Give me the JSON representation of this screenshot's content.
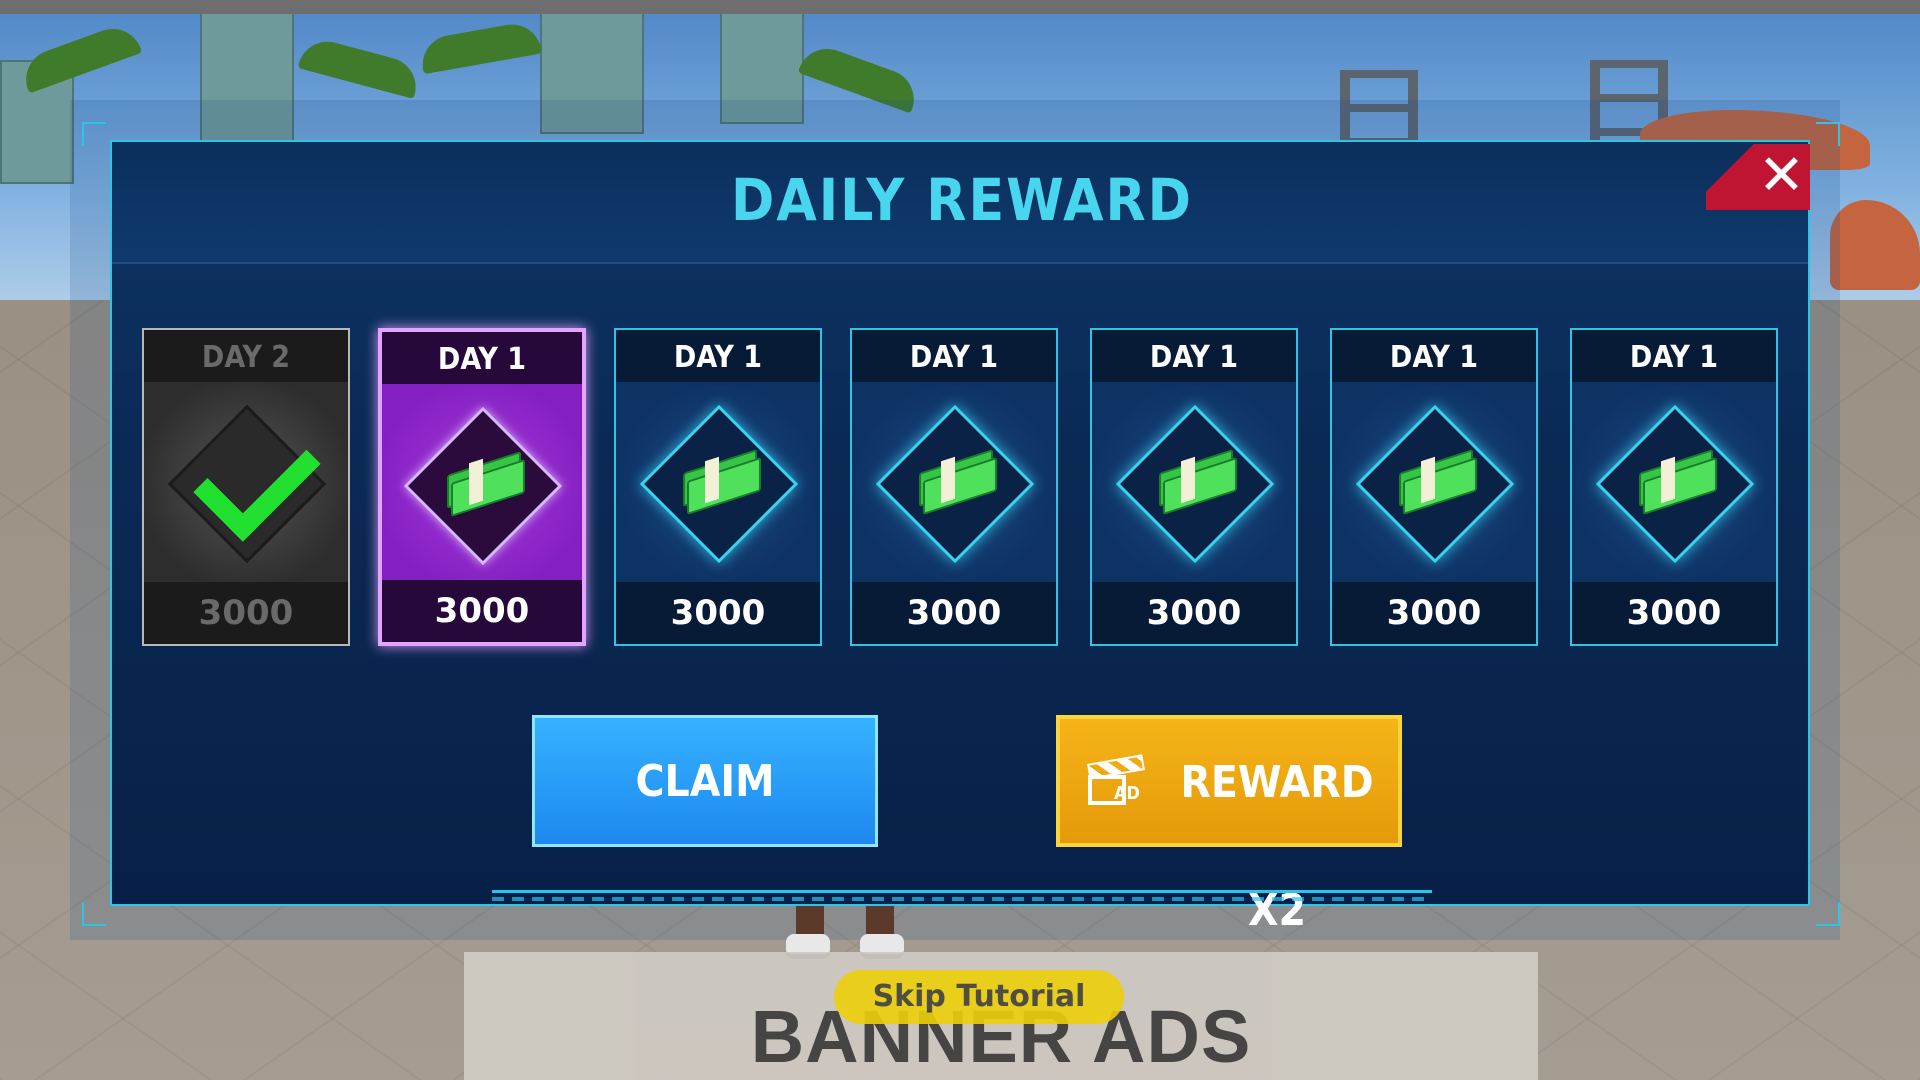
{
  "header": {
    "title": "DAILY REWARD"
  },
  "close_button": {
    "icon": "close-icon",
    "glyph": "✕"
  },
  "days": [
    {
      "label": "DAY 2",
      "amount": "3000",
      "state": "claimed",
      "icon": "checkmark-icon"
    },
    {
      "label": "DAY 1",
      "amount": "3000",
      "state": "current",
      "icon": "cash-stack-icon"
    },
    {
      "label": "DAY 1",
      "amount": "3000",
      "state": "locked",
      "icon": "cash-stack-icon"
    },
    {
      "label": "DAY 1",
      "amount": "3000",
      "state": "locked",
      "icon": "cash-stack-icon"
    },
    {
      "label": "DAY 1",
      "amount": "3000",
      "state": "locked",
      "icon": "cash-stack-icon"
    },
    {
      "label": "DAY 1",
      "amount": "3000",
      "state": "locked",
      "icon": "cash-stack-icon"
    },
    {
      "label": "DAY 1",
      "amount": "3000",
      "state": "locked",
      "icon": "cash-stack-icon"
    }
  ],
  "buttons": {
    "claim": "CLAIM",
    "reward_x2": "REWARD X2",
    "ad_badge": "AD"
  },
  "tutorial": {
    "skip_label": "Skip Tutorial"
  },
  "banner": {
    "text": "BANNER ADS"
  },
  "colors": {
    "title": "#48d6ee",
    "panel_border": "#2bc5e8",
    "claim_button": "#1d88ef",
    "reward_button": "#f6b418",
    "close_button": "#c01433",
    "active_card": "#8420c2",
    "check": "#22e02f"
  }
}
